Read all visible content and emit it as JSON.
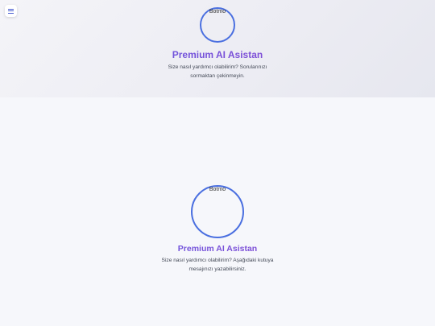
{
  "header": {
    "avatar_alt": "Botmo",
    "title": "Premium AI Asistan",
    "subtitle": "Size nasıl yardımcı olabilirim? Sorularınızı sormaktan çekinmeyin."
  },
  "main": {
    "avatar_alt": "Botmo",
    "title": "Premium AI Asistan",
    "subtitle": "Size nasıl yardımcı olabilirim? Aşağıdaki kutuya mesajınızı yazabilirsiniz."
  },
  "icons": {
    "menu": "hamburger-menu-icon"
  },
  "colors": {
    "accent": "#4a6fe0",
    "title_gradient_start": "#5b5fe3",
    "title_gradient_end": "#a044c9"
  }
}
